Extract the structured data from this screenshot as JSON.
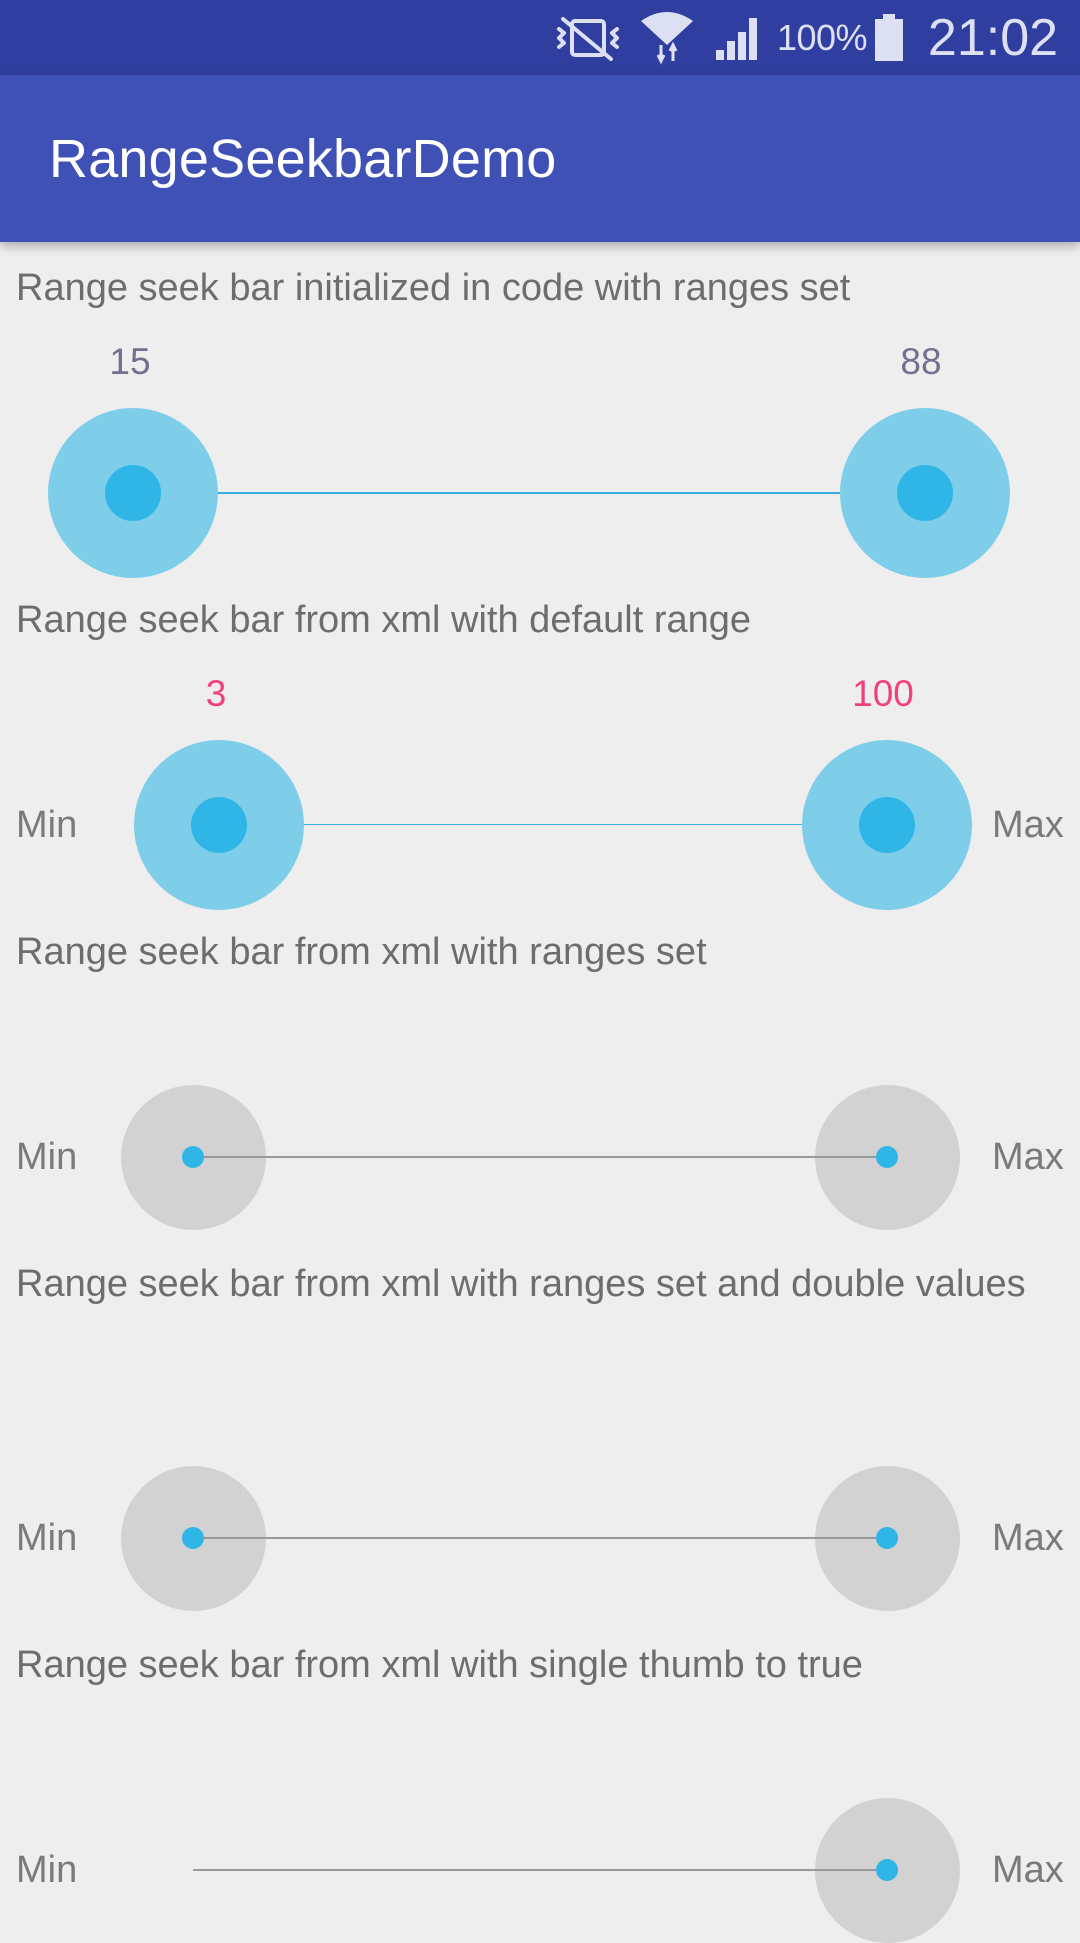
{
  "status_bar": {
    "battery_percent": "100%",
    "time": "21:02",
    "icons": [
      "vibrate-icon",
      "wifi-icon",
      "signal-icon",
      "battery-icon"
    ]
  },
  "app_bar": {
    "title": "RangeSeekbarDemo"
  },
  "colors": {
    "status_bar": "#303f9f",
    "app_bar": "#3f51b5",
    "background": "#eeeeee",
    "thumb_active": "#2fb5e6",
    "thumb_halo_active": "#7ecde9",
    "thumb_halo_inactive": "#d2d2d2",
    "value_label_grey": "#72708e",
    "value_label_pink": "#f0427a"
  },
  "sections": [
    {
      "title": "Range seek bar initialized in code with ranges set",
      "min_value_label": "15",
      "max_value_label": "88"
    },
    {
      "title": "Range seek bar from xml with default range",
      "min_value_label": "3",
      "max_value_label": "100",
      "min_text": "Min",
      "max_text": "Max"
    },
    {
      "title": "Range seek bar from xml with ranges set",
      "min_text": "Min",
      "max_text": "Max"
    },
    {
      "title": "Range seek bar from xml with ranges set and double values",
      "min_text": "Min",
      "max_text": "Max"
    },
    {
      "title": "Range seek bar from xml with single thumb to true",
      "min_text": "Min",
      "max_text": "Max"
    }
  ]
}
